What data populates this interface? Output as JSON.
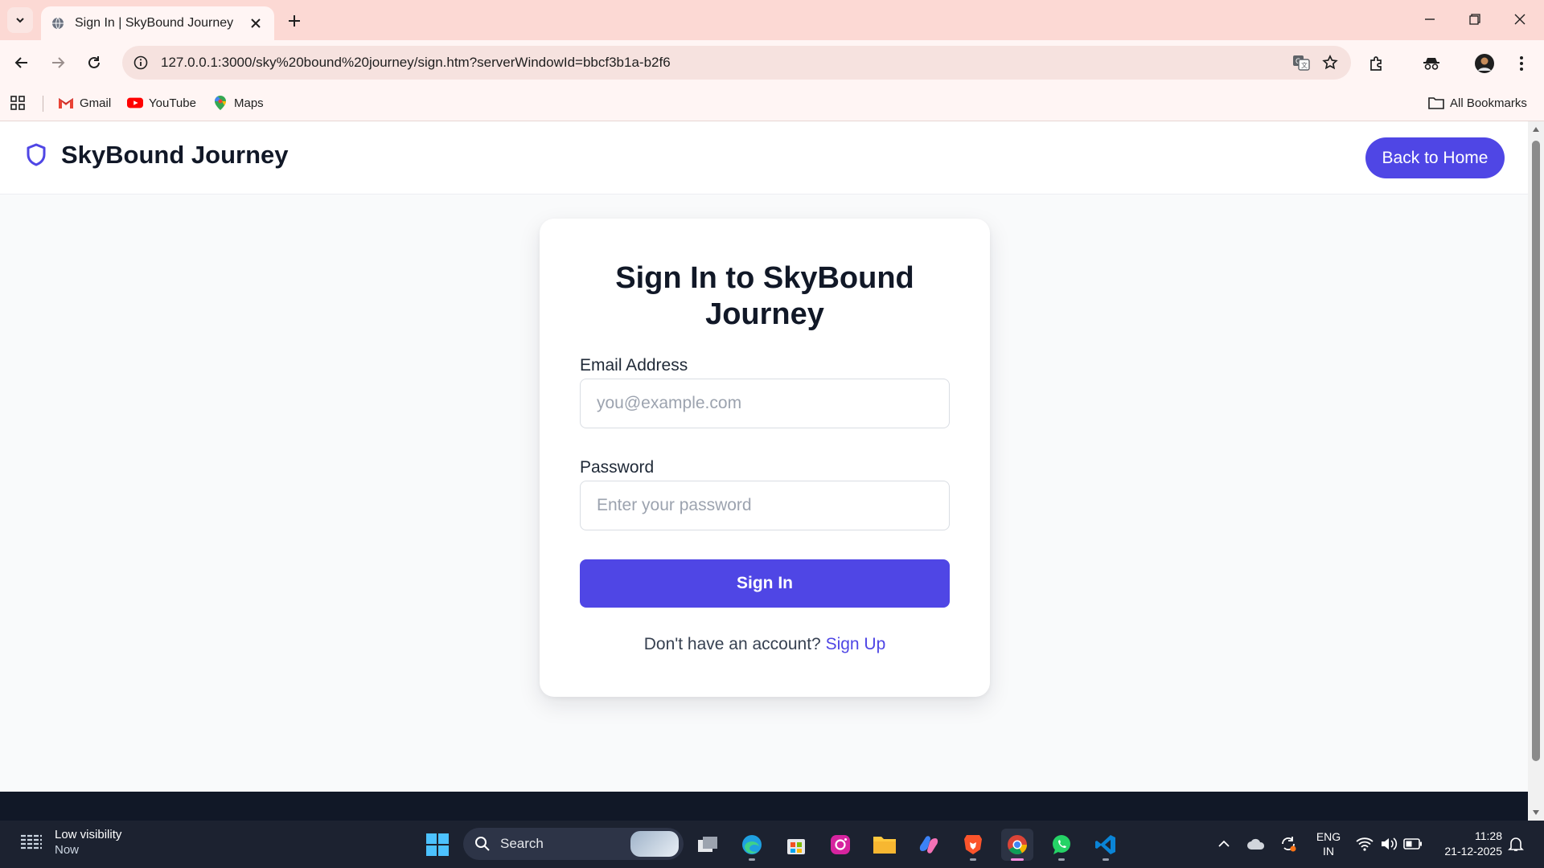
{
  "browser": {
    "tab_title": "Sign In | SkyBound Journey",
    "url": "127.0.0.1:3000/sky%20bound%20journey/sign.htm?serverWindowId=bbcf3b1a-b2f6",
    "bookmarks": [
      {
        "label": "Gmail",
        "icon": "gmail-icon"
      },
      {
        "label": "YouTube",
        "icon": "youtube-icon"
      },
      {
        "label": "Maps",
        "icon": "maps-icon"
      }
    ],
    "all_bookmarks_label": "All Bookmarks"
  },
  "header": {
    "brand_name": "SkyBound Journey",
    "back_home_label": "Back to Home"
  },
  "signin": {
    "title": "Sign In to SkyBound Journey",
    "email_label": "Email Address",
    "email_placeholder": "you@example.com",
    "email_value": "",
    "password_label": "Password",
    "password_placeholder": "Enter your password",
    "password_value": "",
    "submit_label": "Sign In",
    "no_account_text": "Don't have an account?",
    "signup_link": "Sign Up"
  },
  "taskbar": {
    "weather_title": "Low visibility",
    "weather_sub": "Now",
    "search_label": "Search",
    "lang_line1": "ENG",
    "lang_line2": "IN",
    "time": "11:28",
    "date": "21-12-2025"
  },
  "colors": {
    "accent": "#4f46e5",
    "tabbar": "#fcd9d4",
    "taskbar": "#1c2230"
  }
}
